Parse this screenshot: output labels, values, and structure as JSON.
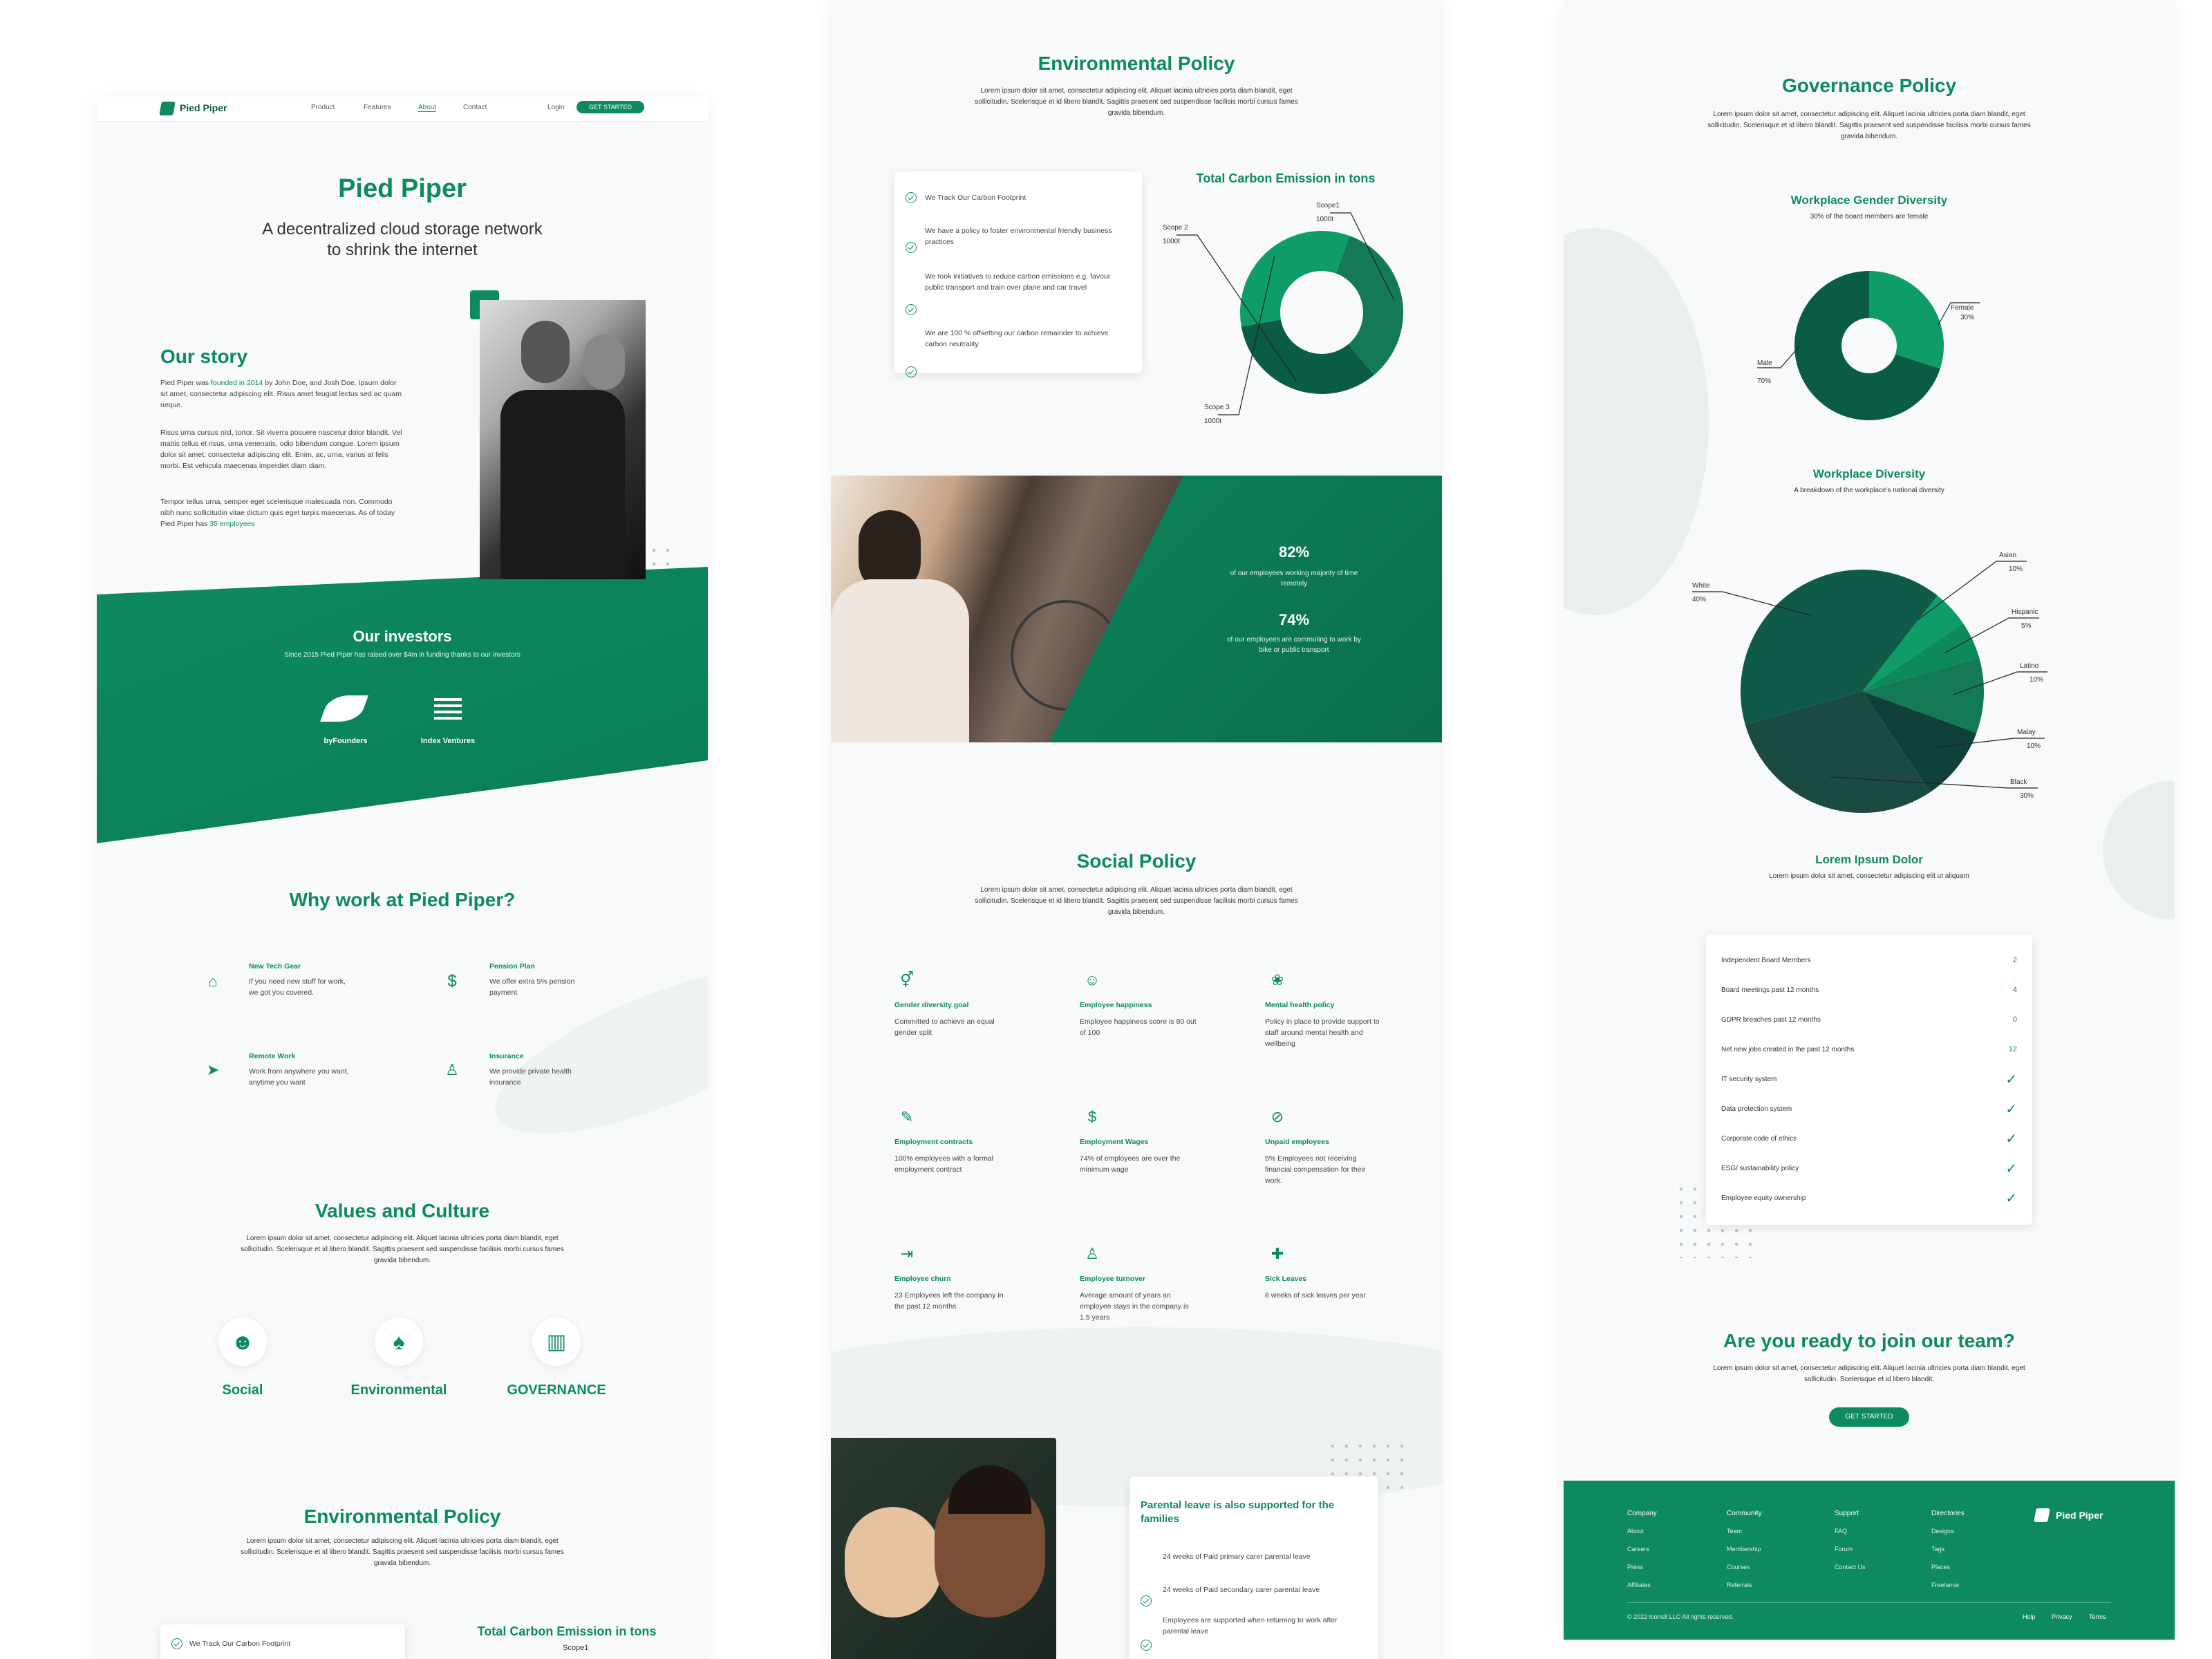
{
  "colors": {
    "accent": "#0e8a5f",
    "dark": "#0b5c45",
    "bg": "#f7f9fa"
  },
  "nav": {
    "brand": "Pied Piper",
    "links": [
      "Product",
      "Features",
      "About",
      "Contact"
    ],
    "login": "Login",
    "cta": "GET STARTED"
  },
  "hero": {
    "title": "Pied Piper",
    "subtitle_line1": "A decentralized cloud storage network",
    "subtitle_line2": "to shrink the internet"
  },
  "story": {
    "title": "Our story",
    "p1_a": "Pied Piper was ",
    "p1_link": "founded in 2014",
    "p1_b": " by John Doe, and Josh Doe. Ipsum dolor sit amet, consectetur adipiscing elit. Risus amet feugiat lectus sed ac quam neque.",
    "p2": "Risus urna  cursus nisl, tortor. Sit viverra posuere nascetur dolor blandit. Vel mattis tellus et risus, urna venenatis, odio bibendum congue. Lorem ipsum dolor sit amet, consectetur adipiscing elit. Enim, ac, urna, varius at felis morbi. Est vehicula maecenas imperdiet diam diam.",
    "p3_a": "Tempor tellus urna, semper eget scelerisque malesuada non. Commodo nibh nunc sollicitudin vitae dictum quis eget turpis maecenas.  As of today Pied Piper has ",
    "p3_link": "35 employees"
  },
  "investors": {
    "title": "Our investors",
    "subtitle": "Since 2015 Pied Piper has raised over $4m in funding thanks to our investors",
    "items": [
      {
        "name": "byFounders",
        "icon": "leaf-logo-icon"
      },
      {
        "name": "Index Ventures",
        "icon": "index-logo-icon"
      }
    ]
  },
  "why": {
    "title": "Why work at Pied Piper?",
    "items": [
      {
        "title": "New Tech Gear",
        "text": "If you need new stuff for work, we got you covered.",
        "icon": "github-icon"
      },
      {
        "title": "Pension Plan",
        "text": "We offer extra 5% pension payment",
        "icon": "dollar-icon"
      },
      {
        "title": "Remote Work",
        "text": "Work from anywhere you want, anytime you want",
        "icon": "send-icon"
      },
      {
        "title": "Insurance",
        "text": "We provide private health insurance",
        "icon": "user-plus-icon"
      }
    ]
  },
  "values": {
    "title": "Values and Culture",
    "text": "Lorem ipsum dolor sit amet, consectetur adipiscing elit. Aliquet lacinia ultricies porta diam blandit, eget sollicitudin. Scelerisque et id libero blandit. Sagittis praesent sed suspendisse facilisis morbi cursus fames gravida bibendum.",
    "items": [
      {
        "label": "Social",
        "icon": "people-icon"
      },
      {
        "label": "Environmental",
        "icon": "tree-icon"
      },
      {
        "label": "GOVERNANCE",
        "icon": "building-icon"
      }
    ]
  },
  "env": {
    "title": "Environmental Policy",
    "text": "Lorem ipsum dolor sit amet, consectetur adipiscing elit. Aliquet lacinia ultricies porta diam blandit, eget sollicitudin. Scelerisque et id libero blandit. Sagittis praesent sed suspendisse facilisis morbi cursus fames gravida bibendum.",
    "checks": [
      "We Track Our Carbon Footprint",
      "We have a policy to foster environmental friendly business practices",
      "We took initiatives to reduce carbon emissions e.g. favour public transport and train over plane and car travel",
      "We are 100 % offsetting our carbon remainder to achieve carbon neutrality"
    ],
    "chart_title": "Total Carbon Emission in tons"
  },
  "stats": [
    {
      "value": "82%",
      "text": "of our employees working majority of time remotely"
    },
    {
      "value": "74%",
      "text": "of our employees are commuting to work by bike or public transport"
    }
  ],
  "social": {
    "title": "Social Policy",
    "text": "Lorem ipsum dolor sit amet, consectetur adipiscing elit. Aliquet lacinia ultricies porta diam blandit, eget sollicitudin. Scelerisque et id libero blandit. Sagittis praesent sed suspendisse facilisis morbi cursus fames gravida bibendum.",
    "items": [
      {
        "title": "Gender diversity goal",
        "text": "Committed to achieve an equal gender split",
        "icon": "gender-icon"
      },
      {
        "title": "Employee happiness",
        "text": "Employee happiness score is 80 out of 100",
        "icon": "smile-icon"
      },
      {
        "title": "Mental health policy",
        "text": "Policy in place to provide support to staff around mental health and wellbeing",
        "icon": "lotus-icon"
      },
      {
        "title": "Employment contracts",
        "text": "100% employees with a formal employment contract",
        "icon": "contract-icon"
      },
      {
        "title": "Employment Wages",
        "text": "74% of employees are over the minimum wage",
        "icon": "money-icon"
      },
      {
        "title": "Unpaid employees",
        "text": "5% Employees not receiving financial compensation for their work.",
        "icon": "no-money-icon"
      },
      {
        "title": "Employee churn",
        "text": "23 Employees left the company in the past 12 months",
        "icon": "exit-icon"
      },
      {
        "title": "Employee turnover",
        "text": "Average amount of years an employee stays in the company is 1.5 years",
        "icon": "user-star-icon"
      },
      {
        "title": "Sick Leaves",
        "text": "8 weeks of sick leaves per year",
        "icon": "plus-icon"
      }
    ]
  },
  "parental": {
    "title": "Parental leave is also supported for the families",
    "items": [
      "24 weeks of Paid primary carer parental leave",
      "24 weeks of Paid secondary carer parental leave",
      "Employees are supported when returning to work after parental leave"
    ]
  },
  "gov": {
    "title": "Governance Policy",
    "text": "Lorem ipsum dolor sit amet, consectetur adipiscing elit. Aliquet lacinia ultricies porta diam blandit, eget sollicitudin. Scelerisque et id libero blandit. Sagittis praesent sed suspendisse facilisis morbi cursus fames gravida bibendum.",
    "gender_title": "Workplace Gender Diversity",
    "gender_sub": "30% of the board members are female",
    "div_title": "Workplace Diversity",
    "div_sub": "A breakdown of the workplace's national diversity",
    "lorem_title": "Lorem Ipsum Dolor",
    "lorem_sub": "Lorem ipsum dolor sit amet, consectetur adipiscing elit ut aliquam",
    "table": [
      {
        "label": "Independent Board Members",
        "value": "2"
      },
      {
        "label": "Board meetings past 12 months",
        "value": "4"
      },
      {
        "label": "GDPR breaches past 12 months",
        "value": "0"
      },
      {
        "label": "Net new jobs created in the past 12 months",
        "value": "12"
      },
      {
        "label": "IT security system",
        "value": "✓"
      },
      {
        "label": "Data protection system",
        "value": "✓"
      },
      {
        "label": "Corporate code of ethics",
        "value": "✓"
      },
      {
        "label": "ESG/ sustainability policy",
        "value": "✓"
      },
      {
        "label": "Employee equity ownership",
        "value": "✓"
      }
    ]
  },
  "join": {
    "title": "Are you ready to join our team?",
    "text": "Lorem ipsum dolor sit amet, consectetur adipiscing elit. Aliquet lacinia ultricies porta diam blandit, eget sollicitudin. Scelerisque et id libero blandit.",
    "cta": "GET STARTED"
  },
  "footer": {
    "cols": [
      {
        "title": "Company",
        "links": [
          "About",
          "Careers",
          "Press",
          "Affiliates"
        ]
      },
      {
        "title": "Community",
        "links": [
          "Team",
          "Membership",
          "Courses",
          "Referrals"
        ]
      },
      {
        "title": "Support",
        "links": [
          "FAQ",
          "Forum",
          "Contact Us"
        ]
      },
      {
        "title": "Directories",
        "links": [
          "Designs",
          "Tags",
          "Places",
          "Freelance"
        ]
      }
    ],
    "brand": "Pied Piper",
    "copyright": "© 2022 Icons8 LLC All rights reserved.",
    "bottom_links": [
      "Help",
      "Privacy",
      "Terms"
    ]
  },
  "chart_data": [
    {
      "type": "pie",
      "title": "Total Carbon Emission in tons",
      "categories": [
        "Scope1",
        "Scope 2",
        "Scope 3"
      ],
      "values": [
        1000,
        1000,
        1000
      ],
      "labels": [
        "1000t",
        "1000t",
        "1000t"
      ]
    },
    {
      "type": "pie",
      "title": "Workplace Gender Diversity",
      "categories": [
        "Female",
        "Male"
      ],
      "values": [
        30,
        70
      ]
    },
    {
      "type": "pie",
      "title": "Workplace Diversity",
      "categories": [
        "Asian",
        "Hispanic",
        "Latino",
        "Malay",
        "Black",
        "White"
      ],
      "values": [
        10,
        5,
        10,
        10,
        30,
        40
      ]
    }
  ]
}
